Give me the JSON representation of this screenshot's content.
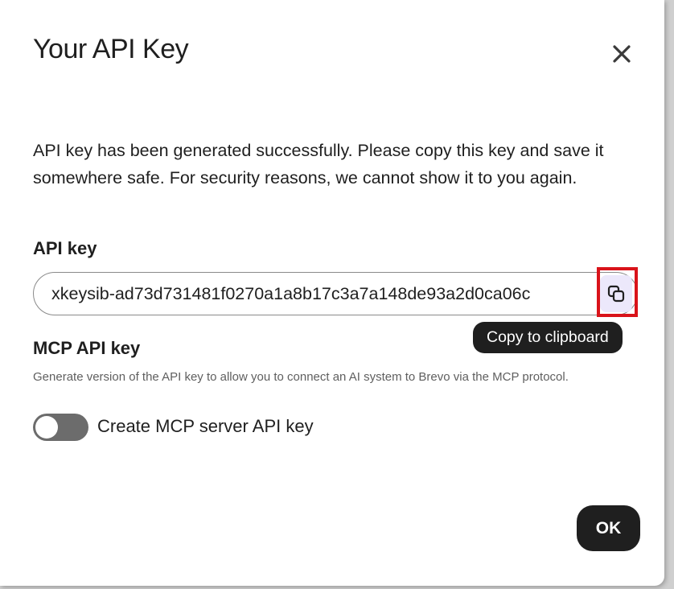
{
  "dialog": {
    "title": "Your API Key",
    "description": "API key has been generated successfully. Please copy this key and save it somewhere safe. For security reasons, we cannot show it to you again.",
    "close_icon": "close-icon"
  },
  "api_key": {
    "label": "API key",
    "value": "xkeysib-ad73d731481f0270a1a8b17c3a7a148de93a2d0ca06c",
    "copy_icon": "copy-icon",
    "tooltip": "Copy to clipboard"
  },
  "mcp": {
    "label": "MCP API key",
    "help_text": "Generate version of the API key to allow you to connect an AI system to Brevo via the MCP protocol.",
    "toggle_label": "Create MCP server API key",
    "toggle_on": false
  },
  "footer": {
    "ok_label": "OK"
  },
  "colors": {
    "text": "#1f1f1f",
    "muted": "#5f5f5f",
    "toggle_off": "#6c6c6c",
    "copy_bg": "#ece8fb",
    "highlight": "#d9131a",
    "button_bg": "#1f1f1f"
  }
}
